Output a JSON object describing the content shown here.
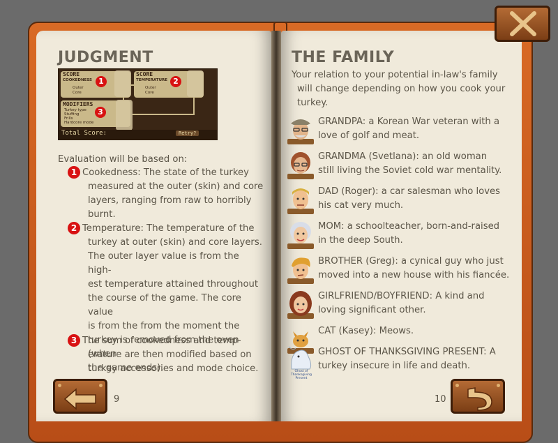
{
  "left_page": {
    "title": "JUDGMENT",
    "preview": {
      "score1_title": "SCORE",
      "score1_sub": "COOKEDNESS",
      "score1_rows": [
        "Outer",
        "Core"
      ],
      "score2_title": "SCORE",
      "score2_sub": "TEMPERATURE",
      "score2_rows": [
        "Outer",
        "Core"
      ],
      "modifiers_title": "MODIFIERS",
      "modifiers_rows": [
        "Turkey type",
        "Stuffing",
        "Frills",
        "Hardcore mode"
      ],
      "total_label": "Total Score:",
      "retry_label": "Retry?"
    },
    "eval_intro": "Evaluation will be based on:",
    "items": [
      {
        "num": "1",
        "first": "Cookedness: The state of the turkey",
        "rest": [
          "measured at the outer (skin) and core",
          "layers, ranging from raw to horribly",
          "burnt."
        ]
      },
      {
        "num": "2",
        "first": "Temperature: The temperature of the",
        "rest": [
          "turkey at outer (skin) and core layers.",
          "The outer layer value is from the high-",
          "est temperature attained throughout",
          "the course of the game. The core value",
          "is from the from the moment the",
          "turkey is removed from the oven (when",
          "the game ends)."
        ]
      },
      {
        "num": "3",
        "first": "The sum of cookedness and temp-",
        "rest": [
          "erature are then modified based on",
          "turkey accessories and mode choice."
        ]
      }
    ],
    "page_number": "9"
  },
  "right_page": {
    "title": "THE FAMILY",
    "intro": [
      "Your relation to your potential in-law's family",
      "will change depending on how you cook your",
      "turkey."
    ],
    "characters": [
      {
        "lines": [
          "GRANDPA: a Korean War veteran with a",
          "love of golf and meat."
        ],
        "portrait": "grandpa-portrait"
      },
      {
        "lines": [
          "GRANDMA (Svetlana): an old woman",
          "still living the Soviet cold war mentality."
        ],
        "portrait": "grandma-portrait"
      },
      {
        "lines": [
          "DAD (Roger): a car salesman who loves",
          "his cat very much."
        ],
        "portrait": "dad-portrait"
      },
      {
        "lines": [
          "MOM: a schoolteacher, born-and-raised",
          "in the deep South."
        ],
        "portrait": "mom-portrait"
      },
      {
        "lines": [
          "BROTHER (Greg): a cynical guy who just",
          "moved into a new house with his fiancée."
        ],
        "portrait": "brother-portrait"
      },
      {
        "lines": [
          "GIRLFRIEND/BOYFRIEND: A kind and",
          "loving significant other."
        ],
        "portrait": "girlfriend-portrait"
      },
      {
        "lines": [
          "CAT (Kasey): Meows."
        ],
        "portrait": "cat-portrait"
      },
      {
        "lines": [
          "GHOST OF THANKSGIVING PRESENT: A",
          "turkey insecure in life and death."
        ],
        "portrait": "ghost-portrait",
        "portrait_caption": [
          "Ghost of",
          "Thanksgiving Present"
        ]
      }
    ],
    "page_number": "10"
  },
  "buttons": {
    "back_icon": "back-arrow-icon",
    "return_icon": "return-arrow-icon",
    "close_icon": "close-x-icon"
  },
  "colors": {
    "cover": "#d96a25",
    "paper": "#f0eadb",
    "text": "#5b5548",
    "badge": "#d81212",
    "wood": "#9a5526"
  }
}
